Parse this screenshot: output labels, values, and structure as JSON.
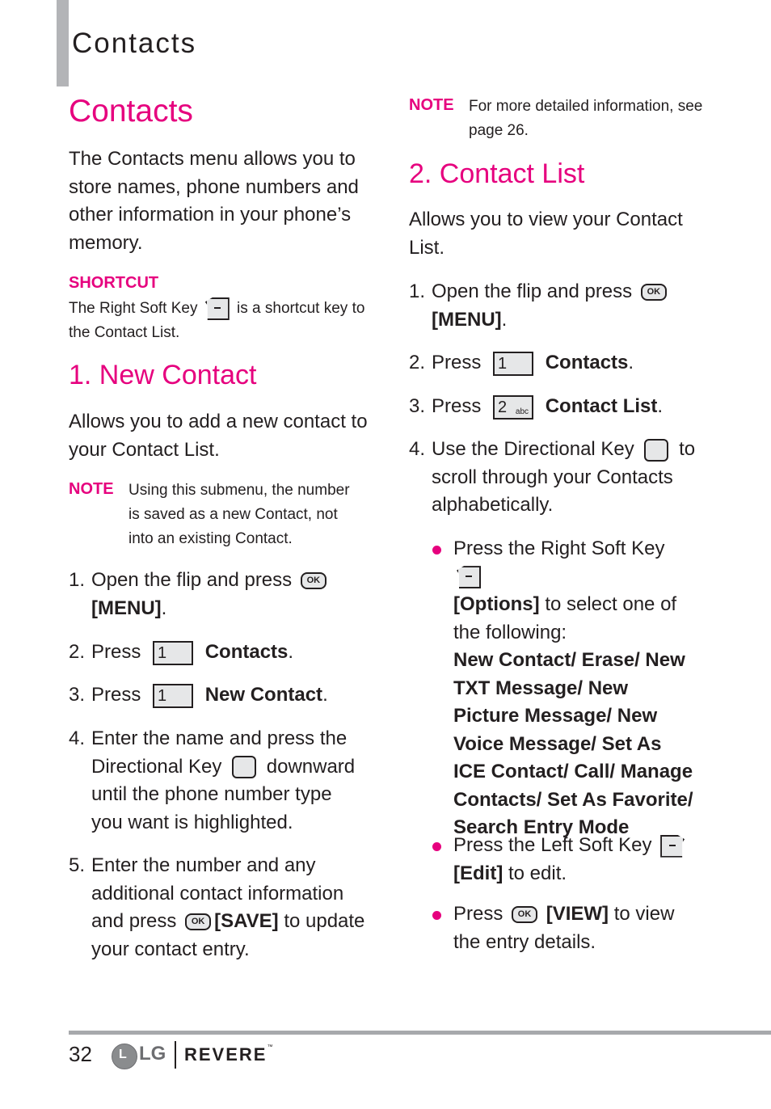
{
  "running_head": "Contacts",
  "left": {
    "title": "Contacts",
    "intro": "The Contacts menu allows you to store names, phone numbers and other information in your phone’s memory.",
    "shortcut": {
      "label": "SHORTCUT",
      "text_before": "The Right Soft Key",
      "text_after": "is a shortcut key to the Contact List.",
      "icon": "right-soft-key-icon"
    },
    "section1": {
      "heading": "1. New Contact",
      "intro": "Allows you to add a new contact to your Contact List.",
      "note_label": "NOTE",
      "note_text": "Using this submenu, the number is saved as a new Contact, not into an existing Contact.",
      "steps": [
        {
          "num": "1.",
          "before": "Open the flip and press",
          "key": "OK",
          "bold": "[MENU]",
          "after": "."
        },
        {
          "num": "2.",
          "before": "Press",
          "key": "1",
          "bold": "Contacts",
          "after": "."
        },
        {
          "num": "3.",
          "before": "Press",
          "key": "1",
          "bold": "New Contact",
          "after": "."
        },
        {
          "num": "4.",
          "before": "Enter the name and press the Directional Key",
          "after": "downward until the phone number type you want is highlighted."
        },
        {
          "num": "5.",
          "before": "Enter the number and any additional contact information and press",
          "key": "OK",
          "bold": "[SAVE]",
          "after": "to update your contact entry."
        }
      ]
    }
  },
  "right": {
    "note_label": "NOTE",
    "note_text": "For more detailed information, see page 26.",
    "section2": {
      "heading": "2. Contact List",
      "intro": "Allows you to view your Contact List.",
      "steps": [
        {
          "num": "1.",
          "before": "Open the flip and press",
          "key": "OK",
          "bold": "[MENU]",
          "after": "."
        },
        {
          "num": "2.",
          "before": "Press",
          "key": "1",
          "bold": "Contacts",
          "after": "."
        },
        {
          "num": "3.",
          "before": "Press",
          "key": "2",
          "key_sub": "abc",
          "bold": "Contact List",
          "after": "."
        },
        {
          "num": "4.",
          "before": "Use the Directional Key",
          "after": "to scroll through your Contacts alphabetically."
        }
      ],
      "bullets": [
        {
          "before": "Press the Right Soft Key",
          "bold": "[Options]",
          "after": "to select one of the following:",
          "options": "New Contact/ Erase/ New TXT Message/ New Picture Message/ New Voice Message/ Set As ICE Contact/ Call/  Manage Contacts/ Set As Favorite/ Search Entry Mode"
        },
        {
          "before": "Press the Left Soft Key",
          "bold": "[Edit]",
          "after": "to edit."
        },
        {
          "before": "Press",
          "key": "OK",
          "bold": "[VIEW]",
          "after": "to view the entry details."
        }
      ]
    }
  },
  "footer": {
    "page_number": "32",
    "logo_mark": "L",
    "logo_text": "LG",
    "brand": "REVERE",
    "trademark": "™"
  },
  "colors": {
    "accent": "#e6007e",
    "text": "#231f20",
    "rule": "#a7a9ac"
  }
}
